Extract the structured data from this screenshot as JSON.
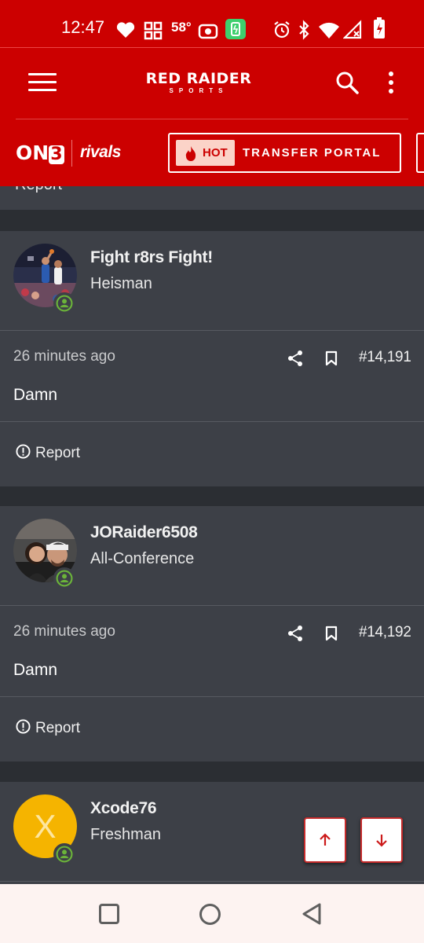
{
  "status_bar": {
    "time": "12:47",
    "temperature": "58°",
    "icons": [
      "heart-icon",
      "grid-icon",
      "hotspot-icon",
      "battery-saver-icon",
      "alarm-icon",
      "bluetooth-icon",
      "wifi-icon",
      "signal-icon",
      "battery-charging-icon"
    ]
  },
  "header": {
    "brand_line1": "RED RAIDER",
    "brand_line2": "SPORTS",
    "icons": [
      "menu-icon",
      "search-icon",
      "more-vertical-icon"
    ]
  },
  "subnav": {
    "on3_prefix": "ON",
    "on3_number": "3",
    "rivals": "rivals",
    "hot_badge": "HOT",
    "portal_label": "TRANSFER PORTAL"
  },
  "partial_post": {
    "text": "Report"
  },
  "posts": [
    {
      "author": "Fight r8rs Fight!",
      "rank": "Heisman",
      "time_ago": "26 minutes ago",
      "post_number": "#14,191",
      "body": "Damn",
      "report_label": "Report"
    },
    {
      "author": "JORaider6508",
      "rank": "All-Conference",
      "time_ago": "26 minutes ago",
      "post_number": "#14,192",
      "body": "Damn",
      "report_label": "Report"
    },
    {
      "author": "Xcode76",
      "rank": "Freshman",
      "avatar_letter": "X"
    }
  ],
  "colors": {
    "brand_red": "#cc0000",
    "card_bg": "#3d4047",
    "page_bg": "#2b2e33",
    "badge_green": "#6bb33a",
    "avatar_yellow": "#f5b400"
  }
}
